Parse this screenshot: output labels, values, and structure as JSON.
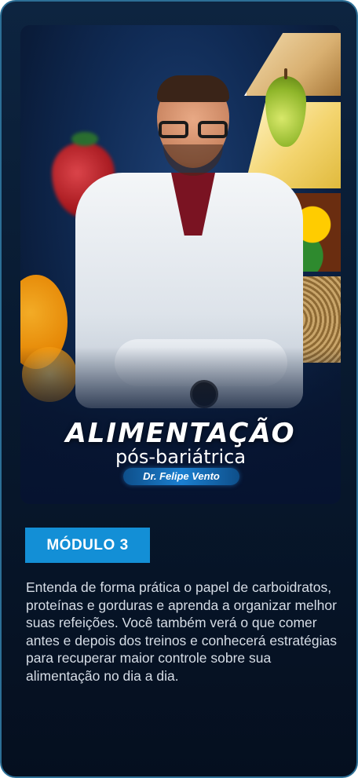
{
  "cover": {
    "title": "ALIMENTAÇÃO",
    "subtitle": "pós-bariátrica",
    "author": "Dr. Felipe Vento"
  },
  "module": {
    "label": "MÓDULO 3"
  },
  "description": "Entenda de forma prática o papel de carboidratos, proteínas e gorduras e aprenda a organizar melhor suas refeições. Você também verá o que comer antes e depois dos treinos e conhecerá estratégias para recuperar maior controle sobre sua alimentação no dia a dia."
}
